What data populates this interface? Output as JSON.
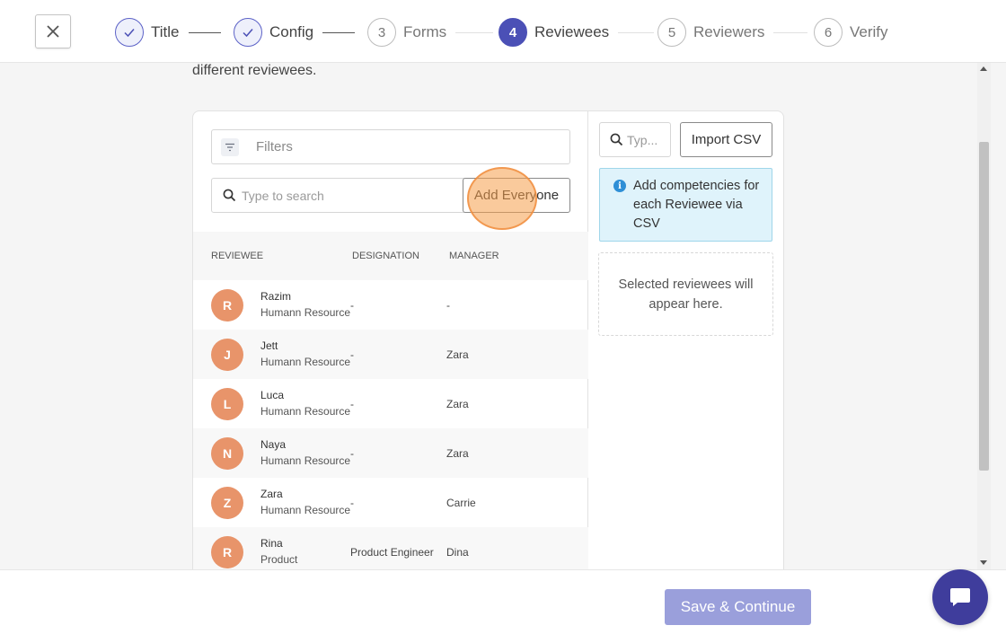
{
  "colors": {
    "accent": "#4b50b6",
    "avatar": "#e8946a",
    "info_bg": "#dff3fb",
    "primary_button": "#9a9fdb",
    "chat": "#3f3d9c"
  },
  "stepper": {
    "steps": [
      {
        "number": "",
        "label": "Title",
        "state": "done",
        "icon": "check-icon"
      },
      {
        "number": "",
        "label": "Config",
        "state": "done",
        "icon": "check-icon"
      },
      {
        "number": "3",
        "label": "Forms",
        "state": "pending"
      },
      {
        "number": "4",
        "label": "Reviewees",
        "state": "active"
      },
      {
        "number": "5",
        "label": "Reviewers",
        "state": "pending"
      },
      {
        "number": "6",
        "label": "Verify",
        "state": "pending"
      }
    ]
  },
  "intro_text": "different reviewees.",
  "left": {
    "filters_placeholder": "Filters",
    "search_placeholder": "Type to search",
    "add_everyone_label": "Add Everyone",
    "columns": {
      "reviewee": "REVIEWEE",
      "designation": "DESIGNATION",
      "manager": "MANAGER"
    },
    "rows": [
      {
        "initial": "R",
        "name": "Razim",
        "dept": "Humann Resource",
        "designation": "-",
        "manager": "-"
      },
      {
        "initial": "J",
        "name": "Jett",
        "dept": "Humann Resource",
        "designation": "-",
        "manager": "Zara"
      },
      {
        "initial": "L",
        "name": "Luca",
        "dept": "Humann Resource",
        "designation": "-",
        "manager": "Zara"
      },
      {
        "initial": "N",
        "name": "Naya",
        "dept": "Humann Resource",
        "designation": "-",
        "manager": "Zara"
      },
      {
        "initial": "Z",
        "name": "Zara",
        "dept": "Humann Resource",
        "designation": "-",
        "manager": "Carrie"
      },
      {
        "initial": "R",
        "name": "Rina",
        "dept": "Product",
        "designation": "Product Engineer",
        "manager": "Dina"
      }
    ]
  },
  "right": {
    "search_placeholder": "Typ...",
    "import_label": "Import CSV",
    "info_text": "Add competencies for each Reviewee via CSV",
    "empty_text": "Selected reviewees will appear here."
  },
  "footer": {
    "save_label": "Save & Continue"
  }
}
